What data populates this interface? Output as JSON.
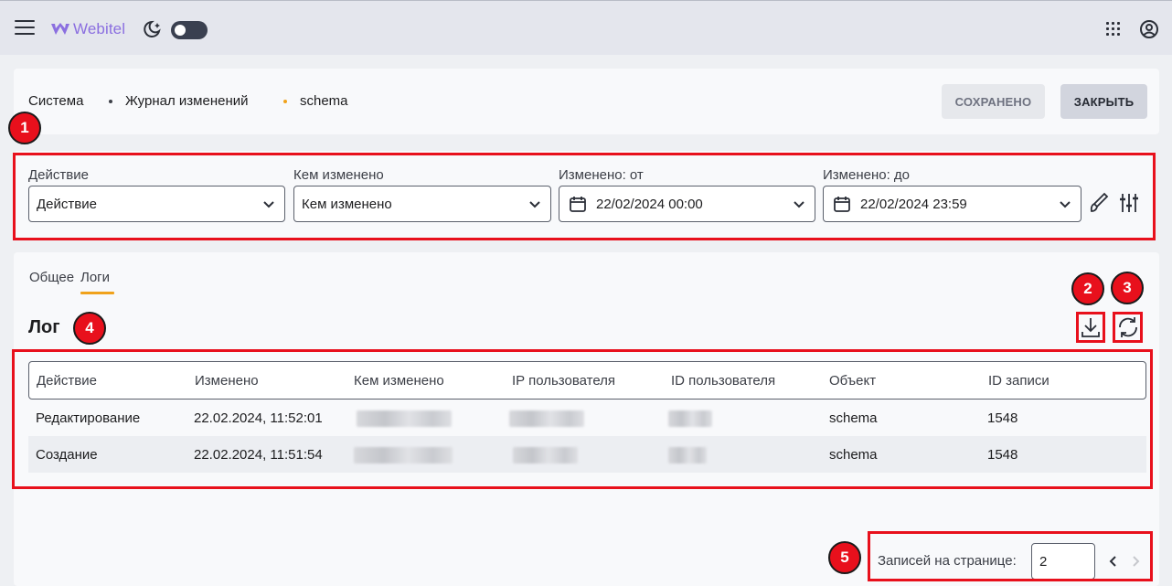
{
  "topbar": {
    "brand": "Webitel",
    "icons": [
      "menu-icon",
      "webitel-logo",
      "theme-moon-icon",
      "theme-toggle",
      "apps-grid-icon",
      "account-icon"
    ]
  },
  "breadcrumbs": [
    "Система",
    "Журнал изменений",
    "schema"
  ],
  "header_buttons": {
    "saved": "СОХРАНЕНО",
    "close": "ЗАКРЫТЬ"
  },
  "filters": [
    {
      "label": "Действие",
      "value": "Действие"
    },
    {
      "label": "Кем изменено",
      "value": "Кем изменено"
    },
    {
      "label": "Изменено: от",
      "value": "22/02/2024 00:00"
    },
    {
      "label": "Изменено: до",
      "value": "22/02/2024 23:59"
    }
  ],
  "tabs": [
    "Общее",
    "Логи"
  ],
  "active_tab": "Логи",
  "log_title": "Лог",
  "table": {
    "headers": [
      "Действие",
      "Изменено",
      "Кем изменено",
      "IP пользователя",
      "ID пользователя",
      "Объект",
      "ID записи"
    ],
    "rows": [
      {
        "action": "Редактирование",
        "changed": "22.02.2024, 11:52:01",
        "object": "schema",
        "record_id": "1548"
      },
      {
        "action": "Создание",
        "changed": "22.02.2024, 11:51:54",
        "object": "schema",
        "record_id": "1548"
      }
    ]
  },
  "pagination": {
    "label": "Записей на странице:",
    "per_page": "2"
  },
  "annotations": [
    "1",
    "2",
    "3",
    "4",
    "5"
  ],
  "colors": {
    "accent": "#f0a21b",
    "highlight": "#e8101c",
    "brand": "#8b6fe0"
  }
}
